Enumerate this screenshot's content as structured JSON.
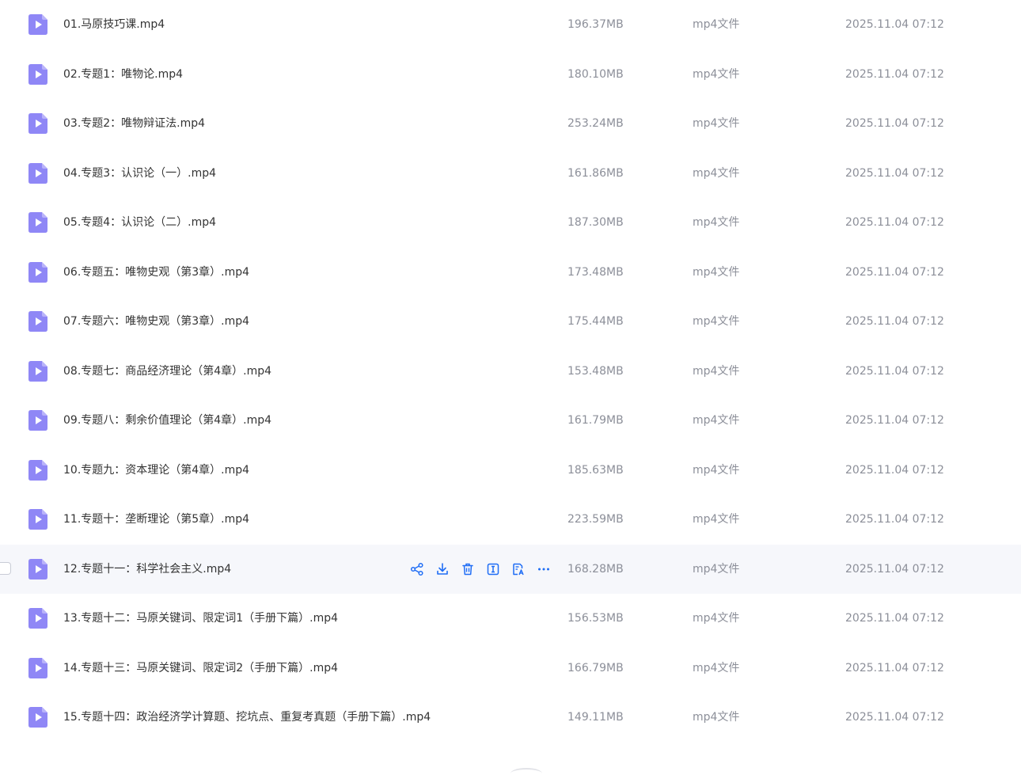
{
  "colors": {
    "icon_accent": "#8f87f6",
    "icon_fold": "#b9b3fa",
    "action_accent": "#1f6df5",
    "hover_row": "#f6f7fb"
  },
  "hovered_actions": [
    "share-icon",
    "download-icon",
    "delete-icon",
    "rename-icon",
    "translate-icon",
    "more-icon"
  ],
  "files": [
    {
      "name": "01.马原技巧课.mp4",
      "size": "196.37MB",
      "type": "mp4文件",
      "date": "2025.11.04 07:12"
    },
    {
      "name": "02.专题1：唯物论.mp4",
      "size": "180.10MB",
      "type": "mp4文件",
      "date": "2025.11.04 07:12"
    },
    {
      "name": "03.专题2：唯物辩证法.mp4",
      "size": "253.24MB",
      "type": "mp4文件",
      "date": "2025.11.04 07:12"
    },
    {
      "name": "04.专题3：认识论（一）.mp4",
      "size": "161.86MB",
      "type": "mp4文件",
      "date": "2025.11.04 07:12"
    },
    {
      "name": "05.专题4：认识论（二）.mp4",
      "size": "187.30MB",
      "type": "mp4文件",
      "date": "2025.11.04 07:12"
    },
    {
      "name": "06.专题五：唯物史观（第3章）.mp4",
      "size": "173.48MB",
      "type": "mp4文件",
      "date": "2025.11.04 07:12"
    },
    {
      "name": "07.专题六：唯物史观（第3章）.mp4",
      "size": "175.44MB",
      "type": "mp4文件",
      "date": "2025.11.04 07:12"
    },
    {
      "name": "08.专题七：商品经济理论（第4章）.mp4",
      "size": "153.48MB",
      "type": "mp4文件",
      "date": "2025.11.04 07:12"
    },
    {
      "name": "09.专题八：剩余价值理论（第4章）.mp4",
      "size": "161.79MB",
      "type": "mp4文件",
      "date": "2025.11.04 07:12"
    },
    {
      "name": "10.专题九：资本理论（第4章）.mp4",
      "size": "185.63MB",
      "type": "mp4文件",
      "date": "2025.11.04 07:12"
    },
    {
      "name": "11.专题十：垄断理论（第5章）.mp4",
      "size": "223.59MB",
      "type": "mp4文件",
      "date": "2025.11.04 07:12"
    },
    {
      "name": "12.专题十一：科学社会主义.mp4",
      "size": "168.28MB",
      "type": "mp4文件",
      "date": "2025.11.04 07:12",
      "hovered": true
    },
    {
      "name": "13.专题十二：马原关键词、限定词1（手册下篇）.mp4",
      "size": "156.53MB",
      "type": "mp4文件",
      "date": "2025.11.04 07:12"
    },
    {
      "name": "14.专题十三：马原关键词、限定词2（手册下篇）.mp4",
      "size": "166.79MB",
      "type": "mp4文件",
      "date": "2025.11.04 07:12"
    },
    {
      "name": "15.专题十四：政治经济学计算题、挖坑点、重复考真题（手册下篇）.mp4",
      "size": "149.11MB",
      "type": "mp4文件",
      "date": "2025.11.04 07:12"
    }
  ]
}
